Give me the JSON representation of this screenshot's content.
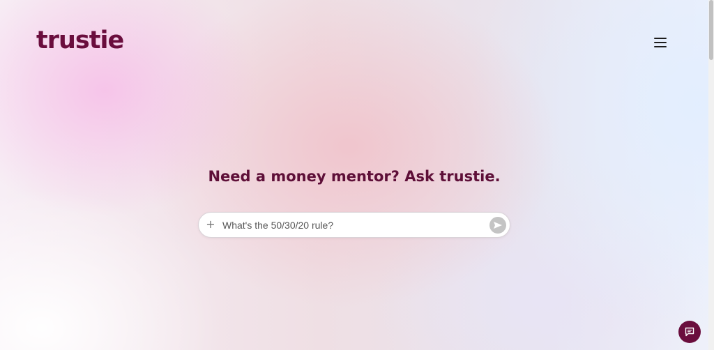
{
  "brand": {
    "logo_text": "trustie",
    "color": "#6a0d3d"
  },
  "header": {
    "menu_icon": "hamburger-menu-icon"
  },
  "hero": {
    "headline": "Need a money mentor? Ask trustie."
  },
  "chat_input": {
    "attach_icon": "plus-icon",
    "attach_glyph": "+",
    "value": "What's the 50/30/20 rule?",
    "placeholder": "",
    "send_icon": "send-icon"
  },
  "chat_widget": {
    "icon": "chat-bubble-icon"
  }
}
